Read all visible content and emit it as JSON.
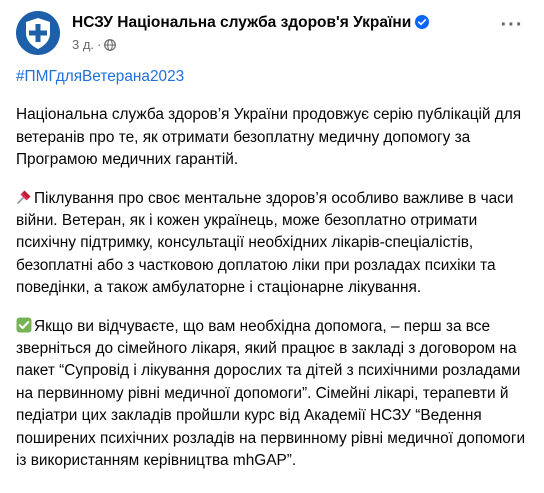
{
  "header": {
    "page_name": "НСЗУ Національна служба здоров'я України",
    "timestamp": "3 д.",
    "separator": "·",
    "verified_icon": "verified-badge-icon",
    "privacy_icon": "globe-icon",
    "more_icon": "more-horizontal-icon",
    "more_label": "···"
  },
  "post": {
    "hashtag": "#ПМГдляВетерана2023",
    "paragraph1": "Національна служба здоров’я України продовжує серію публікацій для ветеранів про те, як отримати безоплатну медичну допомогу за Програмою медичних гарантій.",
    "paragraph2_emoji": "pushpin-icon",
    "paragraph2": "Піклування про своє ментальне здоров’я особливо важливе в часи війни. Ветеран, як і кожен українець, може безоплатно отримати психічну підтримку, консультації необхідних лікарів-спеціалістів, безоплатні або з частковою доплатою ліки при розладах психіки та поведінки, а також амбулаторне і стаціонарне лікування.",
    "paragraph3_emoji": "check-mark-button-icon",
    "paragraph3": "Якщо ви відчуваєте, що вам необхідна допомога, – перш за все зверніться до сімейного лікаря, який працює в закладі з договором на пакет “Супровід і лікування дорослих та дітей з психічними розладами на первинному рівні медичної допомоги”. Сімейні лікарі, терапевти й педіатри цих закладів пройшли курс від Академії НСЗУ “Ведення поширених психічних розладів на первинному рівні медичної допомоги із використанням керівництва mhGAP”."
  },
  "colors": {
    "avatar_bg": "#1d5fa8",
    "hashtag": "#216fdb",
    "verified": "#0866ff",
    "secondary_text": "#65676b",
    "pushpin": "#e0245e",
    "check": "#77b255"
  }
}
